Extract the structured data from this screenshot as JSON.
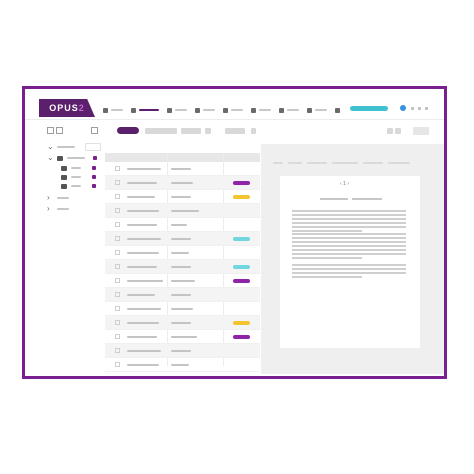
{
  "app": {
    "logo_text": "OPUS",
    "logo_suffix": "2"
  },
  "colors": {
    "brand": "#5b1f6b",
    "frame": "#7a1f8f",
    "search": "#40c1d0",
    "tag_yellow": "#f3c531",
    "tag_cyan": "#72d6de",
    "tag_purple": "#8e24aa",
    "avatar": "#3a90e0"
  },
  "nav": {
    "items": [
      {
        "icon": "home-icon",
        "active": false
      },
      {
        "icon": "documents-icon",
        "active": true
      },
      {
        "icon": "transcript-icon",
        "active": false
      },
      {
        "icon": "list-icon",
        "active": false
      },
      {
        "icon": "edit-icon",
        "active": false
      },
      {
        "icon": "calendar-icon",
        "active": false
      },
      {
        "icon": "warning-icon",
        "active": false
      },
      {
        "icon": "globe-icon",
        "active": false
      },
      {
        "icon": "search-icon",
        "active": false
      }
    ]
  },
  "table": {
    "rows": [
      {
        "tag": ""
      },
      {
        "tag": "purple"
      },
      {
        "tag": "yellow"
      },
      {
        "tag": ""
      },
      {
        "tag": ""
      },
      {
        "tag": "cyan"
      },
      {
        "tag": ""
      },
      {
        "tag": "cyan"
      },
      {
        "tag": "purple"
      },
      {
        "tag": ""
      },
      {
        "tag": ""
      },
      {
        "tag": "yellow"
      },
      {
        "tag": "purple"
      },
      {
        "tag": ""
      },
      {
        "tag": ""
      }
    ]
  },
  "viewer": {
    "pager_text": "‹ 1 ›"
  }
}
